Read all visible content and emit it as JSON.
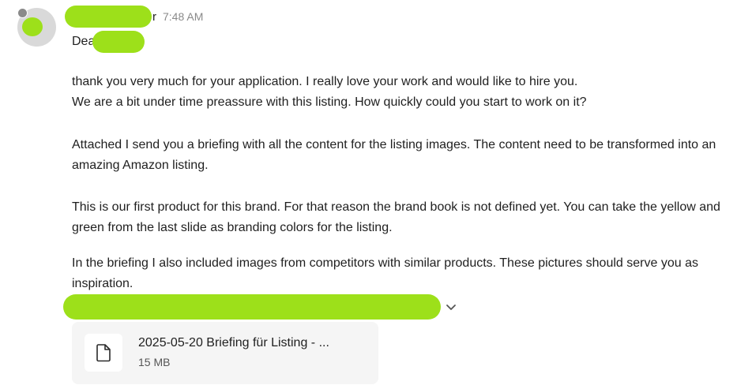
{
  "message": {
    "sender_visible_suffix": "r",
    "timestamp": "7:48 AM",
    "greeting_prefix": "Dea",
    "paragraphs": [
      "thank you very much for your application. I really love your work and would like to hire you.\nWe are a bit under time preassure with this listing. How quickly could you start to work on it?",
      "Attached I send you a briefing with all the content for the listing images. The content need to be transformed into an amazing Amazon listing.",
      "This is our first product for this brand. For that reason the brand book is not defined yet. You can take the yellow and green from the last slide as branding colors for the listing.",
      "In the briefing I also included images from competitors with similar products. These pictures should serve you as inspiration."
    ]
  },
  "attachment": {
    "name": "2025-05-20 Briefing für Listing - ...",
    "size": "15 MB",
    "icon": "file-icon"
  },
  "colors": {
    "redaction": "#9de01a",
    "avatar_bg": "#d9d9d9",
    "timestamp": "#8a8a8a",
    "attachment_bg": "#f5f5f5"
  }
}
